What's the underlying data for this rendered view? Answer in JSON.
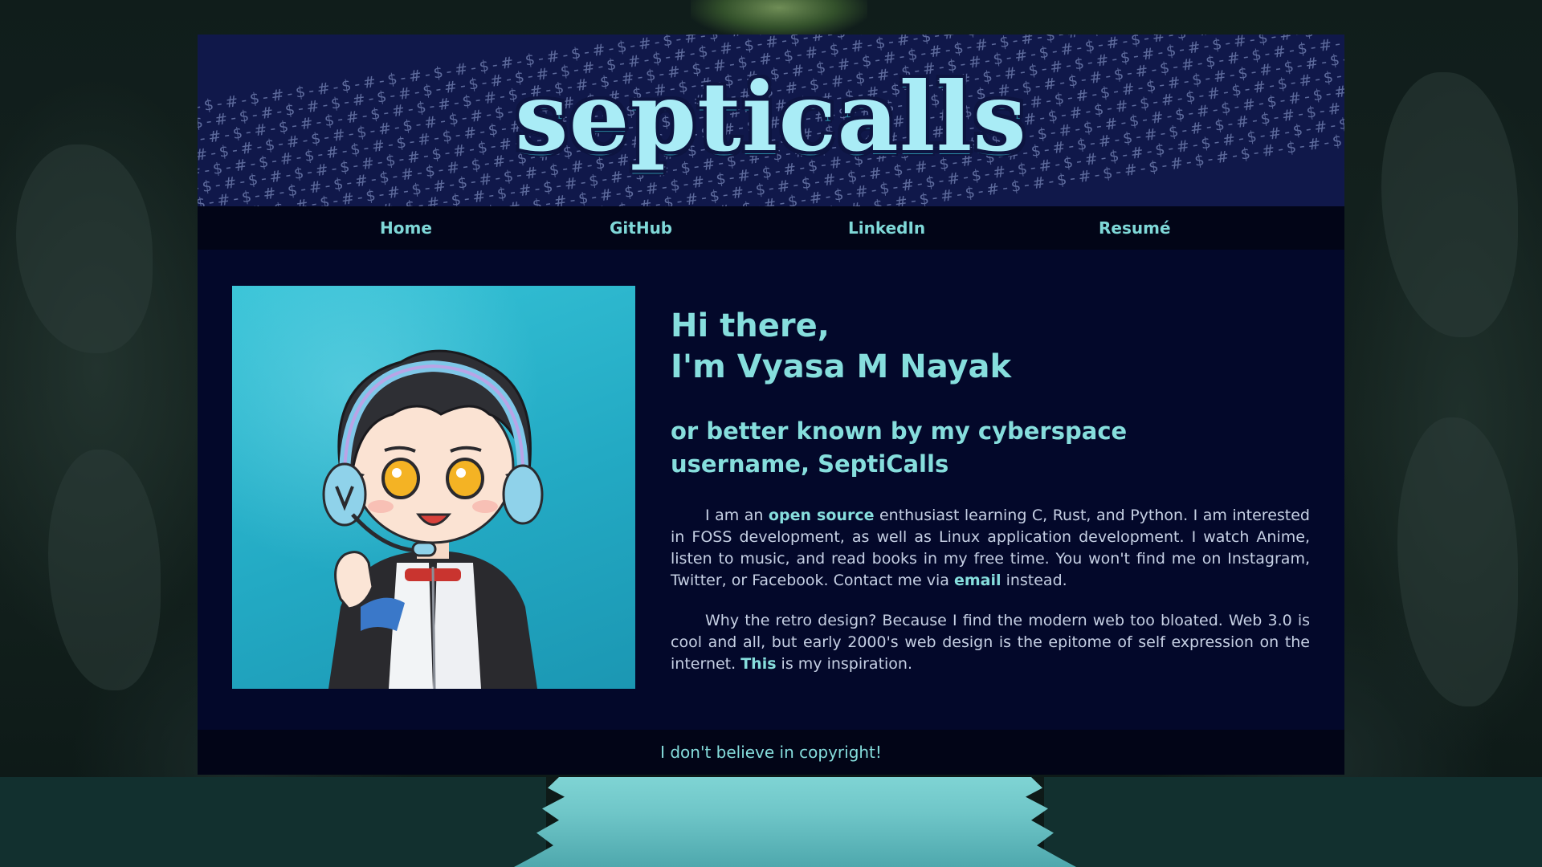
{
  "site": {
    "logo_text": "septicalls",
    "banner_pattern_glyphs": "$-#-"
  },
  "nav": {
    "items": [
      {
        "label": "Home"
      },
      {
        "label": "GitHub"
      },
      {
        "label": "LinkedIn"
      },
      {
        "label": "Resumé"
      }
    ]
  },
  "intro": {
    "greeting_line1": "Hi there,",
    "greeting_line2": "I'm Vyasa M Nayak",
    "subtitle": "or better known by my cyberspace username, SeptiCalls"
  },
  "about": {
    "p1_a": "I am an ",
    "p1_link1": "open source",
    "p1_b": " enthusiast learning C, Rust, and Python. I am interested in FOSS development, as well as Linux application development. I watch Anime, listen to music, and read books in my free time. You won't find me on Instagram, Twitter, or Facebook. Contact me via ",
    "p1_link2": "email",
    "p1_c": " instead.",
    "p2_a": "Why the retro design? Because I find the modern web too bloated. Web 3.0 is cool and all, but early 2000's web design is the epitome of self expression on the internet. ",
    "p2_link": "This",
    "p2_b": " is my inspiration."
  },
  "footer": {
    "text": "I don't believe in copyright!"
  },
  "colors": {
    "page_bg": "#03082a",
    "nav_bg": "#020517",
    "accent": "#86dedd",
    "body_text": "#c6d0e4",
    "banner_bg": "#10184a",
    "logo": "#a9ecf6",
    "avatar_bg": "#2bb5cc"
  }
}
